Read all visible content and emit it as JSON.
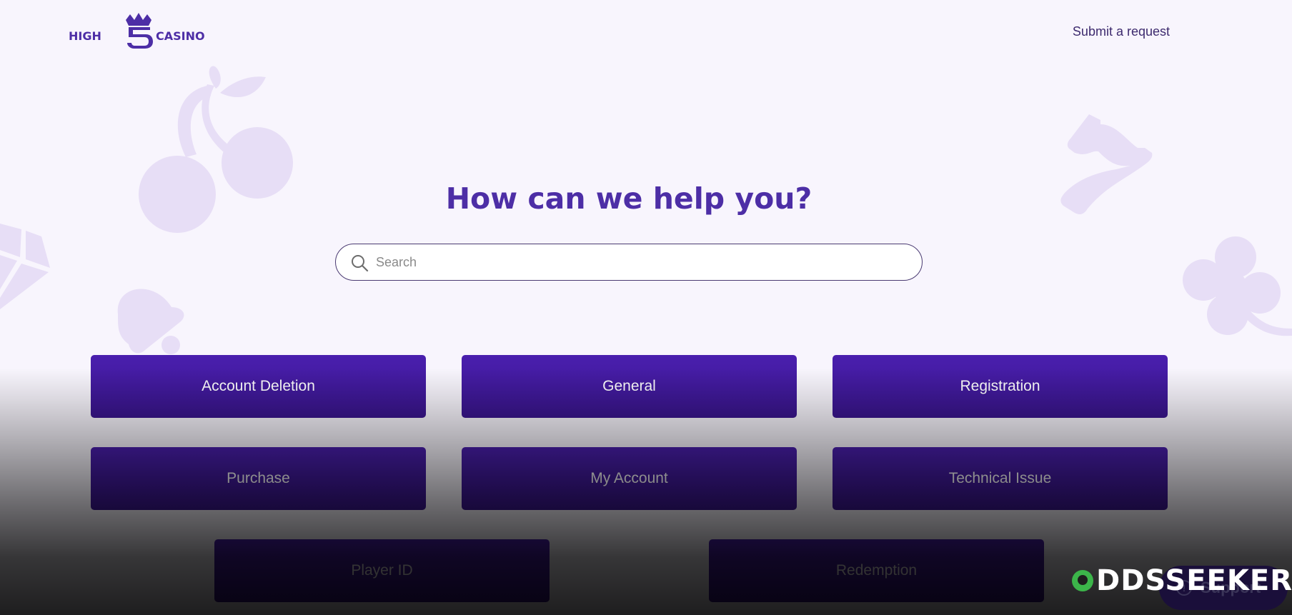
{
  "brand": {
    "logo_left": "HIGH",
    "logo_right": "CASINO",
    "logo_mark": "5",
    "primary_color": "#4d2ea6",
    "button_color": "#4a1fae"
  },
  "header": {
    "submit_request": "Submit a request"
  },
  "hero": {
    "title": "How can we help you?",
    "search_placeholder": "Search",
    "search_value": ""
  },
  "categories": [
    {
      "label": "Account Deletion"
    },
    {
      "label": "General"
    },
    {
      "label": "Registration"
    },
    {
      "label": "Purchase"
    },
    {
      "label": "My Account"
    },
    {
      "label": "Technical Issue"
    },
    {
      "label": "Player ID"
    },
    {
      "label": "Redemption"
    }
  ],
  "support_widget": {
    "label": "Support",
    "icon": "help-circle-icon"
  },
  "watermark": {
    "text": "DDSSEEKER",
    "brand": "ODDSSEEKER",
    "accent_color": "#3cb54a"
  },
  "background_icons": [
    "cherry-icon",
    "diamond-icon",
    "bell-icon",
    "seven-icon",
    "clover-icon"
  ]
}
